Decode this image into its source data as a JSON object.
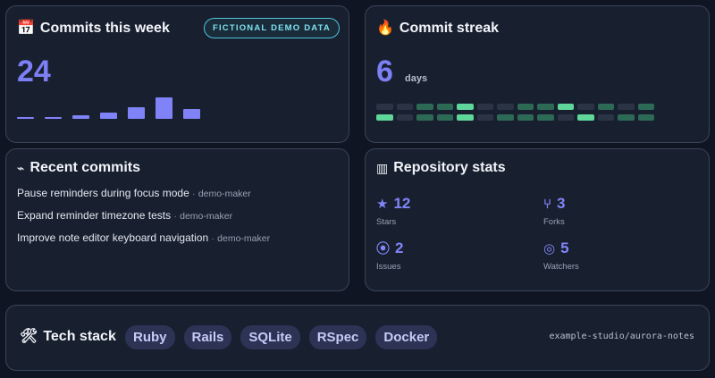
{
  "commits_card": {
    "icon": "calendar-icon",
    "title": "Commits this week",
    "badge": "FICTIONAL DEMO DATA",
    "total": "24",
    "daily_counts": [
      1,
      1,
      2,
      3,
      6,
      11,
      5
    ]
  },
  "streak_card": {
    "icon": "fire-icon",
    "title": "Commit streak",
    "value": "6",
    "unit": "days",
    "heatmap_levels": [
      [
        0,
        0,
        1,
        1,
        2,
        0,
        0,
        1,
        1,
        2,
        0,
        1,
        0,
        1
      ],
      [
        2,
        0,
        1,
        1,
        2,
        0,
        1,
        1,
        1,
        0,
        2,
        0,
        1,
        1
      ]
    ]
  },
  "recent_card": {
    "icon": "commit-icon",
    "title": "Recent commits",
    "commits": [
      {
        "message": "Pause reminders during focus mode",
        "author": "demo-maker"
      },
      {
        "message": "Expand reminder timezone tests",
        "author": "demo-maker"
      },
      {
        "message": "Improve note editor keyboard navigation",
        "author": "demo-maker"
      }
    ],
    "separator": "·"
  },
  "repo_card": {
    "icon": "repository-icon",
    "title": "Repository stats",
    "stats": [
      {
        "icon": "star-icon",
        "value": "12",
        "label": "Stars"
      },
      {
        "icon": "fork-icon",
        "value": "3",
        "label": "Forks"
      },
      {
        "icon": "issue-icon",
        "value": "2",
        "label": "Issues"
      },
      {
        "icon": "eye-icon",
        "value": "5",
        "label": "Watchers"
      }
    ]
  },
  "tech_card": {
    "icon": "tools-icon",
    "title": "Tech stack",
    "chips": [
      "Ruby",
      "Rails",
      "SQLite",
      "RSpec",
      "Docker"
    ],
    "repo": "example-studio/aurora-notes"
  },
  "colors": {
    "accent": "#7d7ff5",
    "badge": "#4fc3d8",
    "heat_levels": [
      "#2b3445",
      "#2d6a55",
      "#5fd79a"
    ]
  }
}
